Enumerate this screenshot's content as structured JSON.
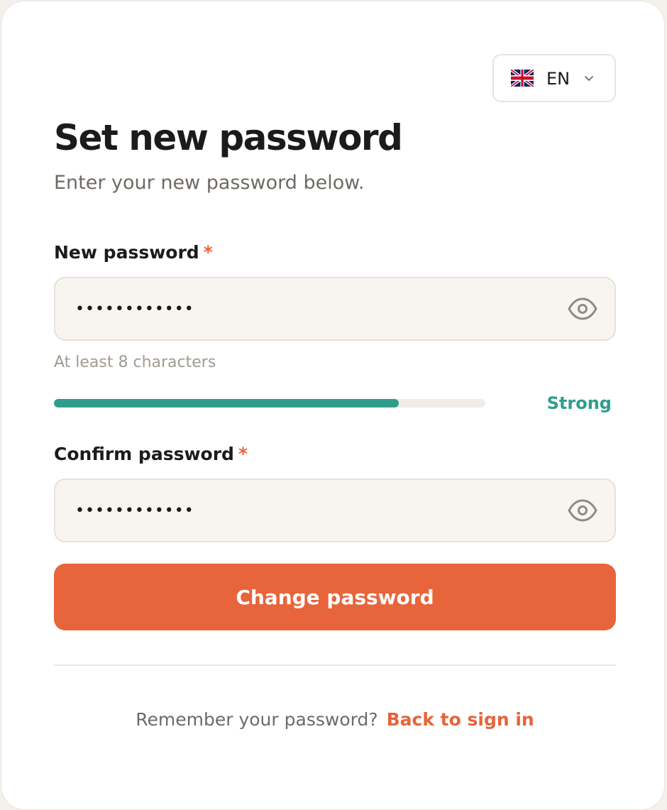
{
  "language": {
    "code": "EN",
    "flag_icon": "uk-flag-icon"
  },
  "header": {
    "title": "Set new password",
    "subtitle": "Enter your new password below."
  },
  "new_password": {
    "label": "New password",
    "required_marker": "*",
    "value": "••••••••••••",
    "hint": "At least 8 characters",
    "toggle_icon": "eye-icon"
  },
  "strength": {
    "label": "Strong",
    "level": 0.8,
    "color": "#2e9e8c"
  },
  "confirm_password": {
    "label": "Confirm password",
    "required_marker": "*",
    "value": "••••••••••••",
    "toggle_icon": "eye-icon"
  },
  "submit": {
    "label": "Change password",
    "color": "#e8643a"
  },
  "footer": {
    "prompt": "Remember your password?",
    "link": "Back to sign in"
  },
  "colors": {
    "accent": "#e8643a",
    "success": "#2e9e8c",
    "text": "#1c1b1a",
    "muted": "#6f6a64"
  }
}
